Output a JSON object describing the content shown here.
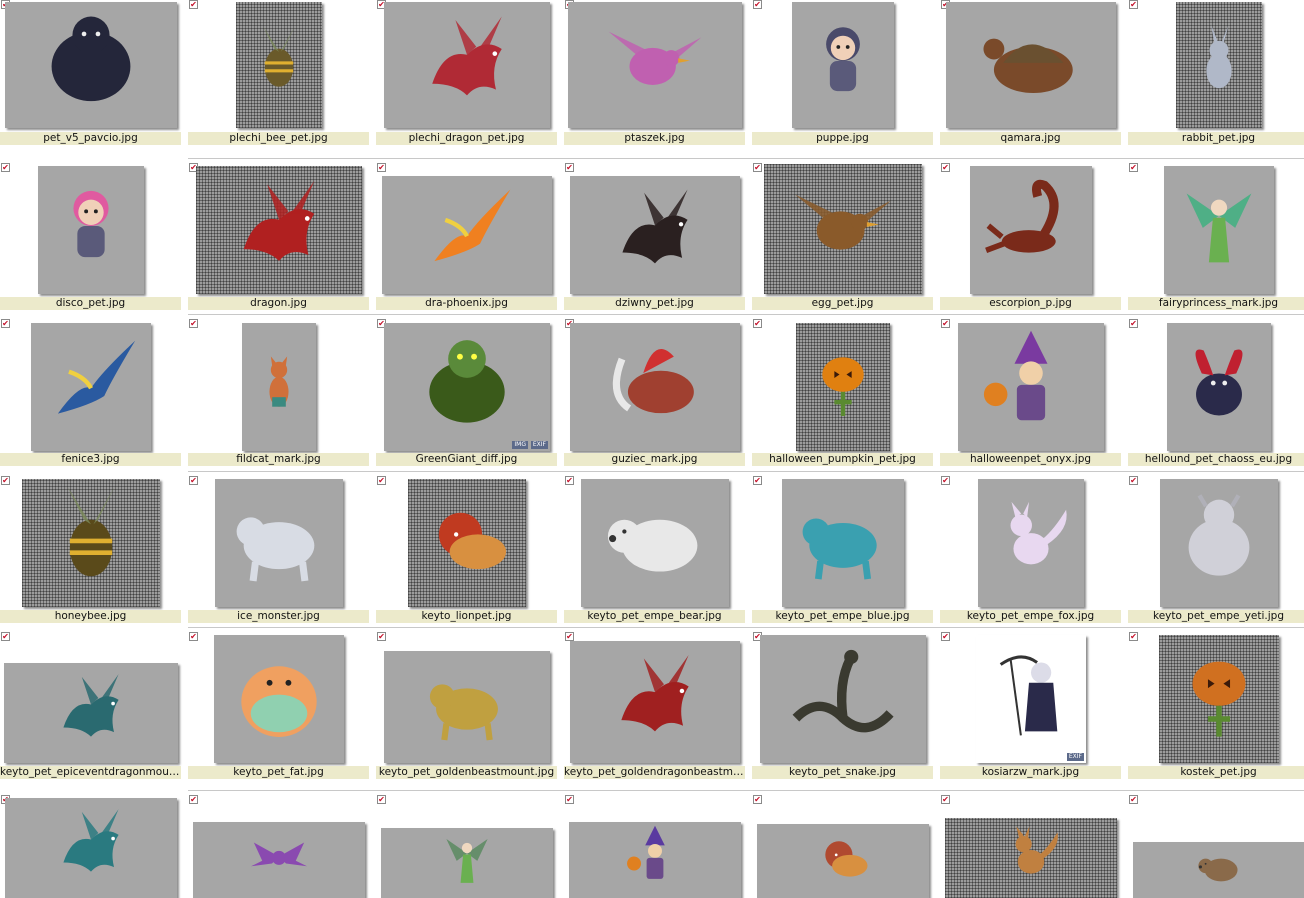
{
  "colors": {
    "label_bg": "#eceacb",
    "thumb_bg": "#a6a6a6",
    "check": "#c4122b"
  },
  "rows": [
    {
      "items": [
        {
          "name": "pet_v5_pavcio.jpg",
          "icon": "gorilla",
          "c": "#24263a",
          "bg": "gray",
          "w": 172,
          "h": 126
        },
        {
          "name": "plechi_bee_pet.jpg",
          "icon": "bee",
          "c": "#6a5a2a",
          "bg": "grid",
          "w": 86,
          "h": 126
        },
        {
          "name": "plechi_dragon_pet.jpg",
          "icon": "dragon",
          "c": "#b02a35",
          "bg": "gray",
          "w": 166,
          "h": 126
        },
        {
          "name": "ptaszek.jpg",
          "icon": "bird",
          "c": "#c060b0",
          "bg": "gray",
          "w": 174,
          "h": 126
        },
        {
          "name": "puppe.jpg",
          "icon": "doll",
          "c": "#4a4a6a",
          "bg": "gray",
          "w": 102,
          "h": 126
        },
        {
          "name": "qamara.jpg",
          "icon": "turtle",
          "c": "#7a4a2a",
          "bg": "gray",
          "w": 170,
          "h": 126
        },
        {
          "name": "rabbit_pet.jpg",
          "icon": "rabbit",
          "c": "#b0b8c8",
          "bg": "grid",
          "w": 86,
          "h": 126
        }
      ]
    },
    {
      "items": [
        {
          "name": "disco_pet.jpg",
          "icon": "doll",
          "c": "#e05aa0",
          "bg": "gray",
          "w": 106,
          "h": 128
        },
        {
          "name": "dragon.jpg",
          "icon": "dragon",
          "c": "#b02020",
          "bg": "grid",
          "w": 166,
          "h": 128
        },
        {
          "name": "dra-phoenix.jpg",
          "icon": "phoenix",
          "c": "#f08020",
          "bg": "gray",
          "w": 170,
          "h": 118
        },
        {
          "name": "dziwny_pet.jpg",
          "icon": "dragon",
          "c": "#2a2020",
          "bg": "gray",
          "w": 170,
          "h": 118
        },
        {
          "name": "egg_pet.jpg",
          "icon": "bird",
          "c": "#8a5a2a",
          "bg": "grid",
          "w": 158,
          "h": 130
        },
        {
          "name": "escorpion_p.jpg",
          "icon": "scorpion",
          "c": "#7a2a1a",
          "bg": "gray",
          "w": 122,
          "h": 128
        },
        {
          "name": "fairyprincess_mark.jpg",
          "icon": "fairy",
          "c": "#40b080",
          "bg": "gray",
          "w": 110,
          "h": 128
        }
      ]
    },
    {
      "items": [
        {
          "name": "fenice3.jpg",
          "icon": "phoenix",
          "c": "#2a5aa0",
          "bg": "gray",
          "w": 120,
          "h": 128
        },
        {
          "name": "fildcat_mark.jpg",
          "icon": "cat",
          "c": "#d0703a",
          "bg": "gray",
          "w": 74,
          "h": 128
        },
        {
          "name": "GreenGiant_diff.jpg",
          "icon": "ogre",
          "c": "#3a5a1a",
          "bg": "gray",
          "w": 166,
          "h": 128,
          "badges": [
            "IMG",
            "EXIF"
          ]
        },
        {
          "name": "guziec_mark.jpg",
          "icon": "boar",
          "c": "#a04030",
          "bg": "gray",
          "w": 170,
          "h": 128
        },
        {
          "name": "halloween_pumpkin_pet.jpg",
          "icon": "pumpkin",
          "c": "#e08010",
          "bg": "grid",
          "w": 94,
          "h": 128
        },
        {
          "name": "halloweenpet_onyx.jpg",
          "icon": "witch",
          "c": "#7a3aa0",
          "bg": "gray",
          "w": 146,
          "h": 128
        },
        {
          "name": "hellound_pet_chaoss_eu.jpg",
          "icon": "demon",
          "c": "#2a2a4a",
          "bg": "gray",
          "w": 104,
          "h": 128
        }
      ]
    },
    {
      "items": [
        {
          "name": "honeybee.jpg",
          "icon": "bee",
          "c": "#5a4a1a",
          "bg": "grid",
          "w": 138,
          "h": 128
        },
        {
          "name": "ice_monster.jpg",
          "icon": "beast",
          "c": "#d8dce4",
          "bg": "gray",
          "w": 128,
          "h": 128
        },
        {
          "name": "keyto_lionpet.jpg",
          "icon": "lion",
          "c": "#c03a20",
          "bg": "grid",
          "w": 118,
          "h": 128
        },
        {
          "name": "keyto_pet_empe_bear.jpg",
          "icon": "bear",
          "c": "#e8e8e8",
          "bg": "gray",
          "w": 148,
          "h": 128
        },
        {
          "name": "keyto_pet_empe_blue.jpg",
          "icon": "beast",
          "c": "#3aa0b0",
          "bg": "gray",
          "w": 122,
          "h": 128
        },
        {
          "name": "keyto_pet_empe_fox.jpg",
          "icon": "fox",
          "c": "#e8d8f0",
          "bg": "gray",
          "w": 106,
          "h": 128
        },
        {
          "name": "keyto_pet_empe_yeti.jpg",
          "icon": "yeti",
          "c": "#d0d0d8",
          "bg": "gray",
          "w": 118,
          "h": 128
        }
      ]
    },
    {
      "items": [
        {
          "name": "keyto_pet_epiceventdragonmount.jpg",
          "icon": "dragon",
          "c": "#2a6a70",
          "bg": "gray",
          "w": 174,
          "h": 100
        },
        {
          "name": "keyto_pet_fat.jpg",
          "icon": "blob",
          "c": "#f0a060",
          "bg": "gray",
          "w": 130,
          "h": 128
        },
        {
          "name": "keyto_pet_goldenbeastmount.jpg",
          "icon": "beast",
          "c": "#c0a040",
          "bg": "gray",
          "w": 166,
          "h": 112
        },
        {
          "name": "keyto_pet_goldendragonbeastmount.jpg",
          "icon": "dragon",
          "c": "#a02020",
          "bg": "gray",
          "w": 170,
          "h": 122
        },
        {
          "name": "keyto_pet_snake.jpg",
          "icon": "snake",
          "c": "#3a3a30",
          "bg": "gray",
          "w": 166,
          "h": 128
        },
        {
          "name": "kosiarzw_mark.jpg",
          "icon": "reaper",
          "c": "#2a2a4a",
          "bg": "white",
          "w": 110,
          "h": 128,
          "badges": [
            "EXIF"
          ]
        },
        {
          "name": "kostek_pet.jpg",
          "icon": "pumpkin",
          "c": "#d07020",
          "bg": "grid",
          "w": 120,
          "h": 128
        }
      ]
    },
    {
      "items": [
        {
          "name": "",
          "icon": "dragon",
          "c": "#2a7a80",
          "bg": "gray",
          "w": 172,
          "h": 100
        },
        {
          "name": "",
          "icon": "bat",
          "c": "#8a4ab0",
          "bg": "gray",
          "w": 172,
          "h": 76
        },
        {
          "name": "",
          "icon": "fairy",
          "c": "#5a8a60",
          "bg": "gray",
          "w": 172,
          "h": 70
        },
        {
          "name": "",
          "icon": "witch",
          "c": "#5a3aa0",
          "bg": "gray",
          "w": 172,
          "h": 76
        },
        {
          "name": "",
          "icon": "lion",
          "c": "#b04a30",
          "bg": "gray",
          "w": 172,
          "h": 74
        },
        {
          "name": "",
          "icon": "fox",
          "c": "#c08040",
          "bg": "grid",
          "w": 172,
          "h": 80
        },
        {
          "name": "",
          "icon": "bear",
          "c": "#8a6a4a",
          "bg": "gray",
          "w": 172,
          "h": 56
        }
      ]
    }
  ]
}
